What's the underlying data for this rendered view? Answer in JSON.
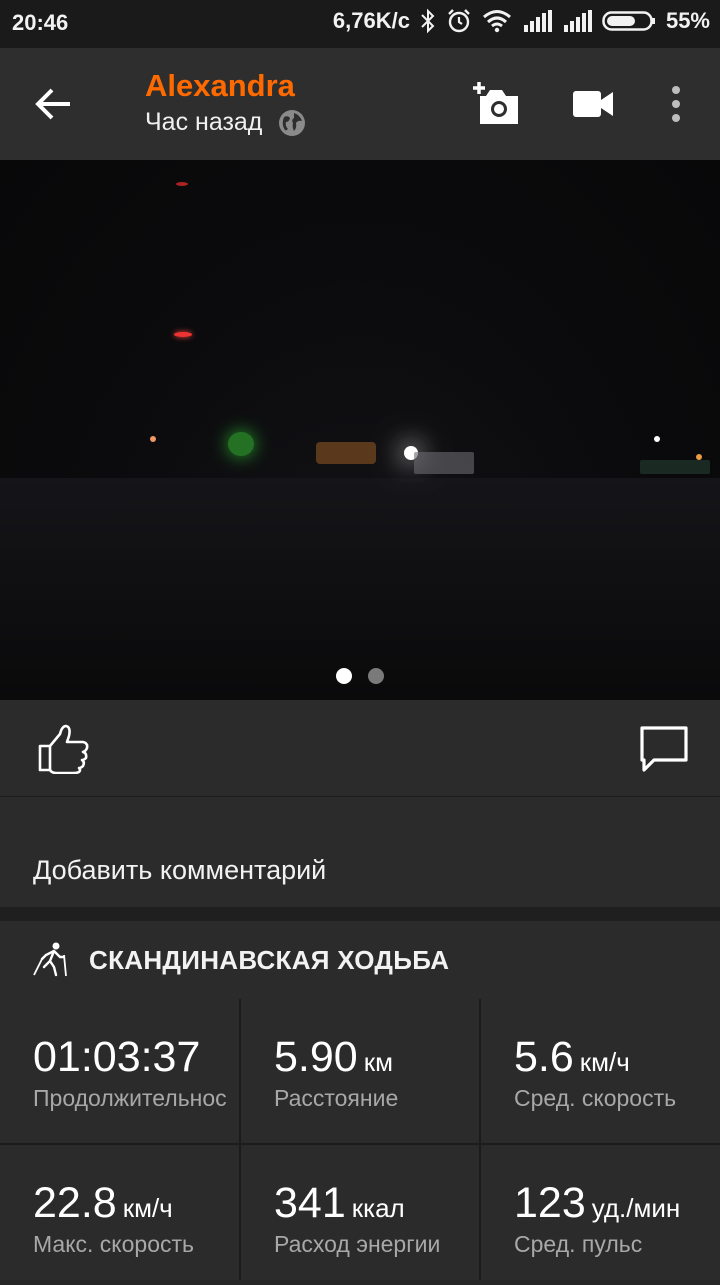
{
  "status_bar": {
    "time": "20:46",
    "network_speed": "6,76K/c",
    "battery": "55%"
  },
  "header": {
    "user_name": "Alexandra",
    "subtitle": "Час назад",
    "icons": [
      "back-arrow-icon",
      "globe-icon",
      "add-photo-icon",
      "video-camera-icon",
      "more-vertical-icon"
    ]
  },
  "photo": {
    "page_count": 2,
    "active_page": 1
  },
  "actions": {
    "icons": [
      "thumbs-up-icon",
      "comment-icon"
    ]
  },
  "comment": {
    "placeholder": "Добавить комментарий"
  },
  "activity": {
    "title": "СКАНДИНАВСКАЯ ХОДЬБА",
    "icon": "nordic-walking-icon",
    "stats": [
      {
        "value": "01:03:37",
        "unit": "",
        "label": "Продолжительнос"
      },
      {
        "value": "5.90",
        "unit": "км",
        "label": "Расстояние"
      },
      {
        "value": "5.6",
        "unit": "км/ч",
        "label": "Сред. скорость"
      },
      {
        "value": "22.8",
        "unit": "км/ч",
        "label": "Макс. скорость"
      },
      {
        "value": "341",
        "unit": "ккал",
        "label": "Расход энергии"
      },
      {
        "value": "123",
        "unit": "уд./мин",
        "label": "Сред. пульс"
      }
    ]
  },
  "colors": {
    "accent": "#ff6a00",
    "background": "#2b2b2b",
    "status_bar": "#1a1a1a"
  }
}
